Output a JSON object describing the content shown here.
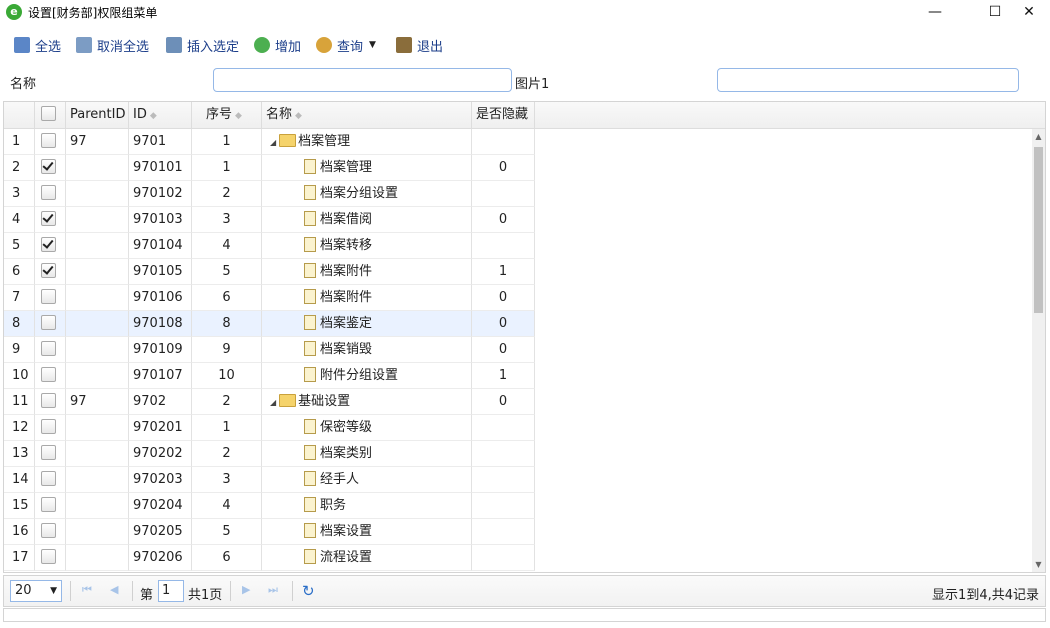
{
  "window": {
    "title": "设置[财务部]权限组菜单",
    "min": "—",
    "max": "☐",
    "close": "✕",
    "app_icon": "e"
  },
  "toolbar": [
    {
      "label": "全选",
      "icon": "select-all-icon",
      "color": "#5b86c7"
    },
    {
      "label": "取消全选",
      "icon": "deselect-all-icon",
      "color": "#7c9cc4"
    },
    {
      "label": "插入选定",
      "icon": "insert-icon",
      "color": "#6d8fb8"
    },
    {
      "label": "增加",
      "icon": "add-icon",
      "color": "#4caf50"
    },
    {
      "label": "查询",
      "icon": "search-icon",
      "color": "#d8a33a"
    },
    {
      "label": "退出",
      "icon": "exit-icon",
      "color": "#8a6d3b"
    }
  ],
  "search": {
    "name_label": "名称",
    "name_value": "",
    "image_label": "图片1",
    "image_value": ""
  },
  "columns": {
    "parent_id": "ParentID",
    "id": "ID",
    "seq": "序号",
    "name": "名称",
    "hidden": "是否隐藏"
  },
  "rows": [
    {
      "n": "1",
      "checked": false,
      "parent": "97",
      "id": "9701",
      "seq": "1",
      "name": "档案管理",
      "type": "folder",
      "hidden": ""
    },
    {
      "n": "2",
      "checked": true,
      "parent": "",
      "id": "970101",
      "seq": "1",
      "name": "档案管理",
      "type": "file",
      "hidden": "0"
    },
    {
      "n": "3",
      "checked": false,
      "parent": "",
      "id": "970102",
      "seq": "2",
      "name": "档案分组设置",
      "type": "file",
      "hidden": ""
    },
    {
      "n": "4",
      "checked": true,
      "parent": "",
      "id": "970103",
      "seq": "3",
      "name": "档案借阅",
      "type": "file",
      "hidden": "0"
    },
    {
      "n": "5",
      "checked": true,
      "parent": "",
      "id": "970104",
      "seq": "4",
      "name": "档案转移",
      "type": "file",
      "hidden": ""
    },
    {
      "n": "6",
      "checked": true,
      "parent": "",
      "id": "970105",
      "seq": "5",
      "name": "档案附件",
      "type": "file",
      "hidden": "1"
    },
    {
      "n": "7",
      "checked": false,
      "parent": "",
      "id": "970106",
      "seq": "6",
      "name": "档案附件",
      "type": "file",
      "hidden": "0"
    },
    {
      "n": "8",
      "checked": false,
      "parent": "",
      "id": "970108",
      "seq": "8",
      "name": "档案鉴定",
      "type": "file",
      "hidden": "0",
      "highlight": true
    },
    {
      "n": "9",
      "checked": false,
      "parent": "",
      "id": "970109",
      "seq": "9",
      "name": "档案销毁",
      "type": "file",
      "hidden": "0"
    },
    {
      "n": "10",
      "checked": false,
      "parent": "",
      "id": "970107",
      "seq": "10",
      "name": "附件分组设置",
      "type": "file",
      "hidden": "1"
    },
    {
      "n": "11",
      "checked": false,
      "parent": "97",
      "id": "9702",
      "seq": "2",
      "name": "基础设置",
      "type": "folder",
      "hidden": "0"
    },
    {
      "n": "12",
      "checked": false,
      "parent": "",
      "id": "970201",
      "seq": "1",
      "name": "保密等级",
      "type": "file",
      "hidden": ""
    },
    {
      "n": "13",
      "checked": false,
      "parent": "",
      "id": "970202",
      "seq": "2",
      "name": "档案类别",
      "type": "file",
      "hidden": ""
    },
    {
      "n": "14",
      "checked": false,
      "parent": "",
      "id": "970203",
      "seq": "3",
      "name": "经手人",
      "type": "file",
      "hidden": ""
    },
    {
      "n": "15",
      "checked": false,
      "parent": "",
      "id": "970204",
      "seq": "4",
      "name": "职务",
      "type": "file",
      "hidden": ""
    },
    {
      "n": "16",
      "checked": false,
      "parent": "",
      "id": "970205",
      "seq": "5",
      "name": "档案设置",
      "type": "file",
      "hidden": ""
    },
    {
      "n": "17",
      "checked": false,
      "parent": "",
      "id": "970206",
      "seq": "6",
      "name": "流程设置",
      "type": "file",
      "hidden": ""
    }
  ],
  "pager": {
    "page_size": "20",
    "page_prefix": "第",
    "page": "1",
    "page_total": "共1页",
    "info": "显示1到4,共4记录"
  }
}
